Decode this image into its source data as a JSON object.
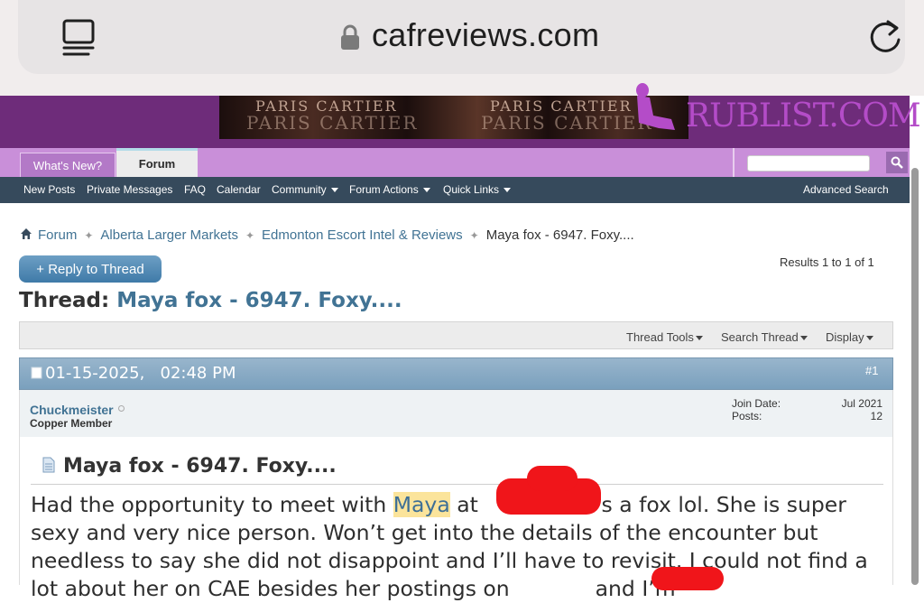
{
  "browser": {
    "url": "cafreviews.com",
    "tabs_icon": "tabs-icon",
    "lock_icon": "lock-icon",
    "reload_icon": "reload-icon"
  },
  "banner": {
    "ad_text": "PARIS CARTIER",
    "sponsor": "RUBLIST.COM"
  },
  "tabs": {
    "whats_new": "What's New?",
    "forum": "Forum"
  },
  "nav": {
    "items": [
      "New Posts",
      "Private Messages",
      "FAQ",
      "Calendar",
      "Community",
      "Forum Actions",
      "Quick Links"
    ],
    "advanced_search": "Advanced Search"
  },
  "breadcrumb": {
    "items": [
      "Forum",
      "Alberta Larger Markets",
      "Edmonton Escort Intel & Reviews",
      "Maya fox - 6947. Foxy...."
    ]
  },
  "thread": {
    "reply_label": "+ Reply to Thread",
    "results": "Results 1 to 1 of 1",
    "label": "Thread:",
    "title": "Maya fox - 6947. Foxy...."
  },
  "tools": {
    "thread_tools": "Thread Tools",
    "search_thread": "Search Thread",
    "display": "Display"
  },
  "post": {
    "date": "01-15-2025,",
    "time": "02:48 PM",
    "number": "#1",
    "username": "Chuckmeister",
    "user_title": "Copper Member",
    "join_date_label": "Join Date:",
    "join_date_value": "Jul 2021",
    "posts_label": "Posts:",
    "posts_value": "12",
    "title": "Maya fox - 6947. Foxy....",
    "text_1": "Had the opportunity to meet with ",
    "highlight_1": "Maya",
    "text_2": " at ",
    "text_3": " She’s a fox lol. She is super sexy and very nice person. Won’t get into the details of the encounter but needless to say she did not disappoint and I’ll have to revisit. I could not find a lot about her on CAE besides her postings on ",
    "text_4": " and I’m"
  },
  "colors": {
    "banner_purple": "#6e2c7a",
    "tab_purple": "#c98fd9",
    "nav_dark": "#364a5c",
    "link_blue": "#417394",
    "redaction_red": "#f0151a"
  }
}
